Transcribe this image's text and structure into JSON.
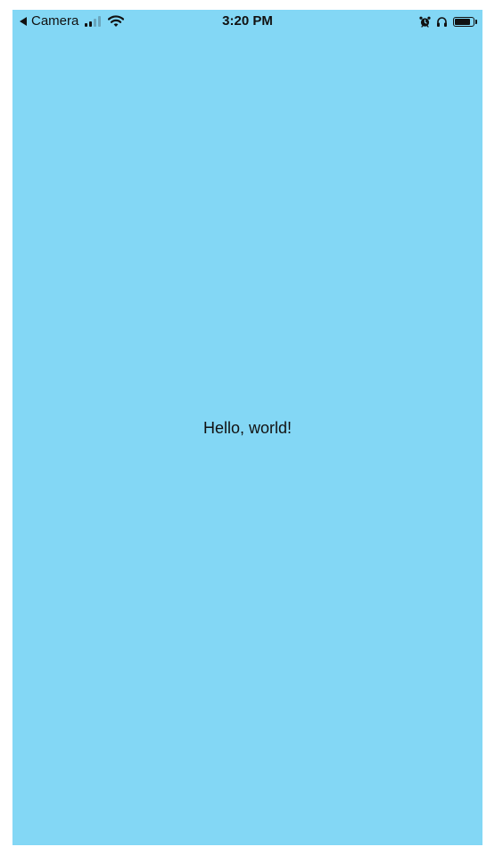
{
  "status_bar": {
    "back_label": "Camera",
    "time": "3:20 PM",
    "signal_bars_filled": 2,
    "signal_bars_total": 4,
    "battery_level": 0.85,
    "icons": [
      "back-arrow-icon",
      "signal-icon",
      "wifi-icon",
      "alarm-icon",
      "headphones-icon",
      "battery-icon"
    ]
  },
  "main": {
    "greeting": "Hello, world!"
  },
  "colors": {
    "background": "#83d7f5",
    "text": "#111111",
    "signal_dim": "#6aa6bd"
  }
}
